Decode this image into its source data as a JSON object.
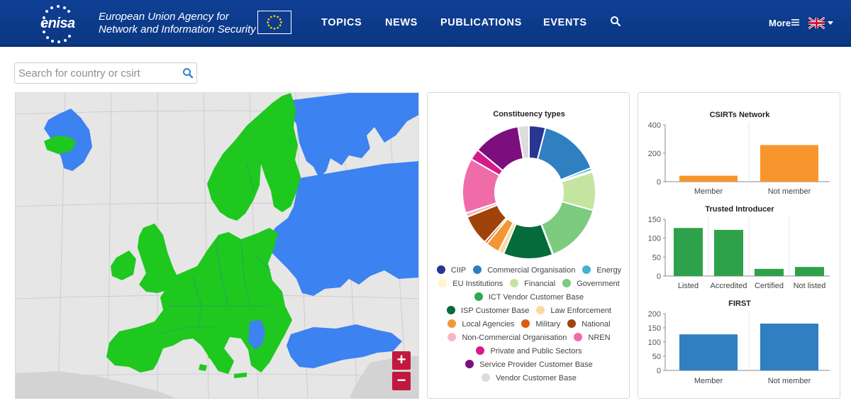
{
  "header": {
    "logo_text": "enisa",
    "agency_line1": "European Union Agency for",
    "agency_line2": "Network and Information Security",
    "nav": [
      "TOPICS",
      "NEWS",
      "PUBLICATIONS",
      "EVENTS"
    ],
    "more_label": "More"
  },
  "search": {
    "placeholder": "Search for country or csirt"
  },
  "map": {
    "zoom_in": "+",
    "zoom_out": "−"
  },
  "colors": {
    "header_bg": "#0e3b8c",
    "accent": "#c1183e",
    "member": "#1ec81e",
    "non_member": "#3c82f0"
  },
  "constituency_chart": {
    "title": "Constituency types",
    "legend_rows": [
      [
        0,
        1,
        2
      ],
      [
        3,
        4,
        5
      ],
      [
        6
      ],
      [
        7,
        8
      ],
      [
        9,
        10,
        11
      ],
      [
        12,
        13
      ],
      [
        14
      ],
      [
        15
      ],
      [
        16
      ]
    ]
  },
  "chart_data": [
    {
      "type": "pie",
      "title": "Constituency types",
      "categories": [
        "CIIP",
        "Commercial Organisation",
        "Energy",
        "EU Institutions",
        "Financial",
        "Government",
        "ICT Vendor Customer Base",
        "ISP Customer Base",
        "Law Enforcement",
        "Local Agencies",
        "Military",
        "National",
        "Non-Commercial Organisation",
        "NREN",
        "Private and Public Sectors",
        "Service Provider Customer Base",
        "Vendor Customer Base"
      ],
      "values": [
        12,
        45,
        2,
        1,
        28,
        44,
        0.5,
        36,
        4,
        10,
        2,
        22,
        3,
        40,
        8,
        34,
        8
      ],
      "colors": [
        "#283593",
        "#2f7fc1",
        "#43b3d1",
        "#fff4c8",
        "#c4e5a0",
        "#7ccb7e",
        "#2fa84f",
        "#066b3a",
        "#fdd9a0",
        "#f39637",
        "#d95f0e",
        "#a0430a",
        "#f7b6c2",
        "#f06ca8",
        "#d31c8c",
        "#7b0f7e",
        "#dcdcdc"
      ]
    },
    {
      "type": "bar",
      "title": "CSIRTs Network",
      "categories": [
        "Member",
        "Not member"
      ],
      "values": [
        42,
        258
      ],
      "ylim": [
        0,
        400
      ],
      "yticks": [
        0,
        200,
        400
      ],
      "color": "#f8962d"
    },
    {
      "type": "bar",
      "title": "Trusted Introducer",
      "categories": [
        "Listed",
        "Accredited",
        "Certified",
        "Not listed"
      ],
      "values": [
        127,
        122,
        19,
        24
      ],
      "ylim": [
        0,
        150
      ],
      "yticks": [
        0,
        50,
        100,
        150
      ],
      "color": "#2ea24a"
    },
    {
      "type": "bar",
      "title": "FIRST",
      "categories": [
        "Member",
        "Not member"
      ],
      "values": [
        127,
        165
      ],
      "ylim": [
        0,
        200
      ],
      "yticks": [
        0,
        50,
        100,
        150,
        200
      ],
      "color": "#2f7fc1"
    }
  ]
}
